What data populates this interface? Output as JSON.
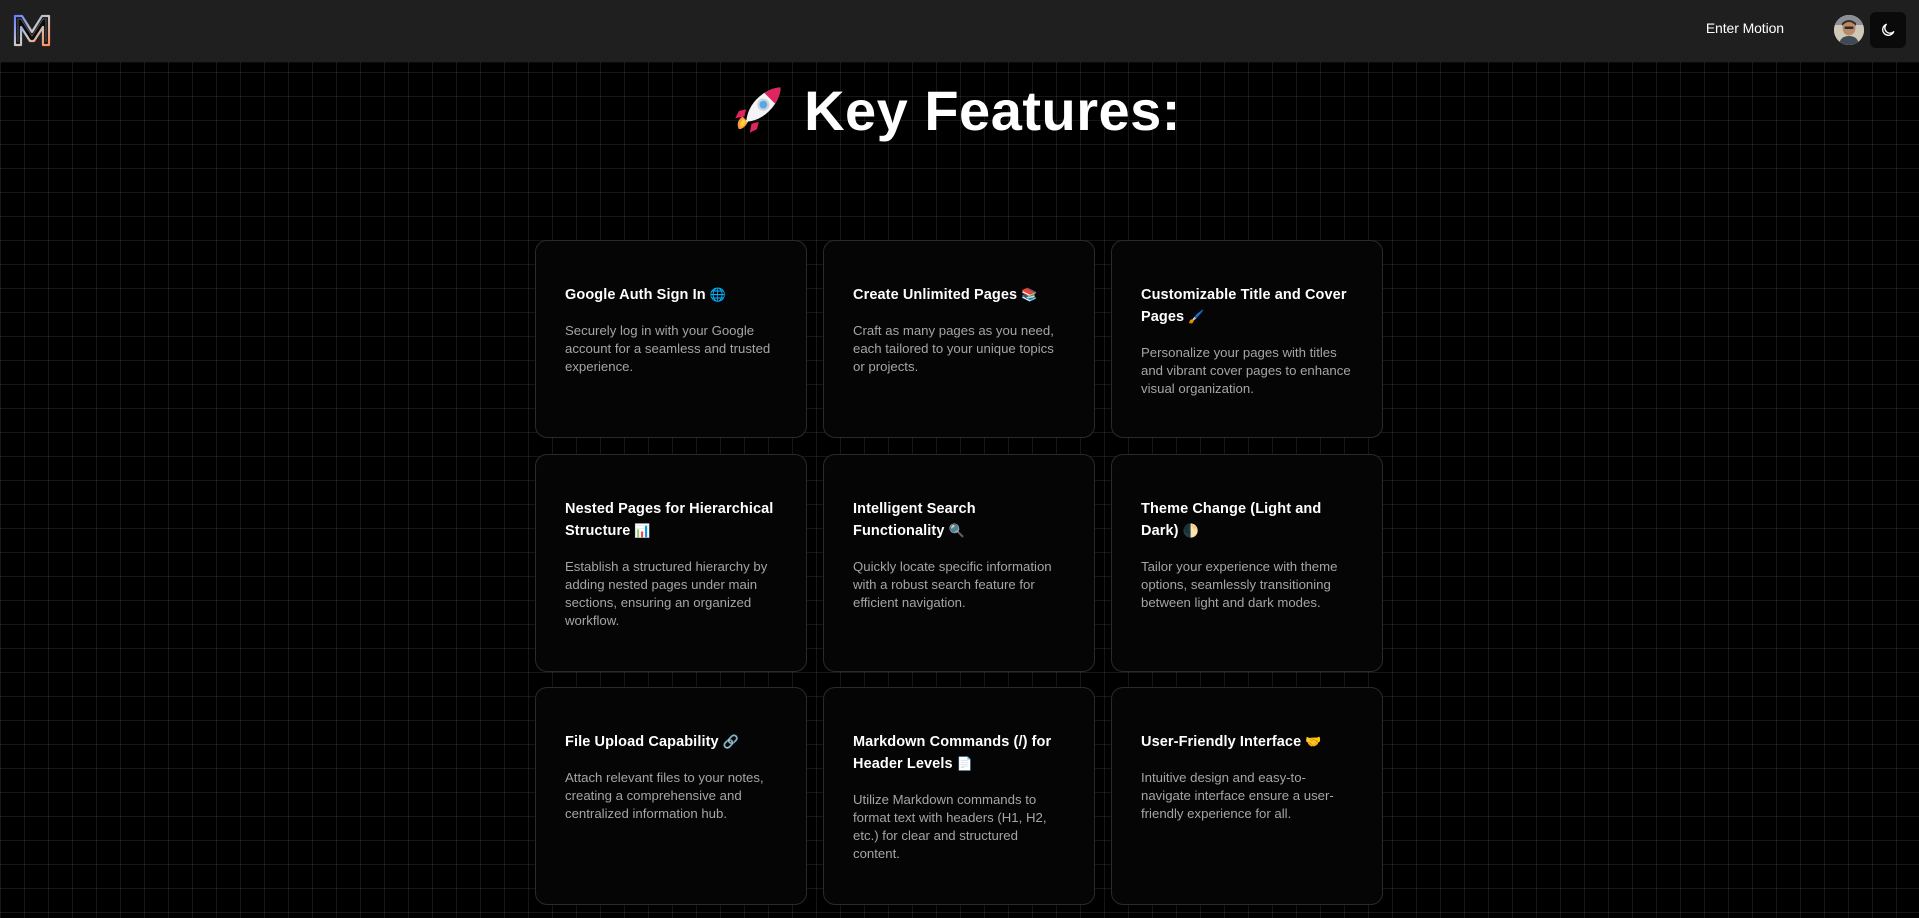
{
  "header": {
    "logo_letter": "M",
    "enter_label": "Enter Motion",
    "theme_icon": "moon-icon"
  },
  "main": {
    "heading": "Key Features:",
    "heading_icon": "rocket-icon",
    "features": [
      {
        "title": "Google Auth Sign In",
        "emoji": "🌐",
        "description": "Securely log in with your Google account for a seamless and trusted experience."
      },
      {
        "title": "Create Unlimited Pages",
        "emoji": "📚",
        "description": "Craft as many pages as you need, each tailored to your unique topics or projects."
      },
      {
        "title": "Customizable Title and Cover Pages",
        "emoji": "🖌️",
        "description": "Personalize your pages with titles and vibrant cover pages to enhance visual organization."
      },
      {
        "title": "Nested Pages for Hierarchical Structure",
        "emoji": "📊",
        "description": "Establish a structured hierarchy by adding nested pages under main sections, ensuring an organized workflow."
      },
      {
        "title": "Intelligent Search Functionality",
        "emoji": "🔍",
        "description": "Quickly locate specific information with a robust search feature for efficient navigation."
      },
      {
        "title": "Theme Change (Light and Dark)",
        "emoji": "🌓",
        "description": "Tailor your experience with theme options, seamlessly transitioning between light and dark modes."
      },
      {
        "title": "File Upload Capability",
        "emoji": "🔗",
        "description": "Attach relevant files to your notes, creating a comprehensive and centralized information hub."
      },
      {
        "title": "Markdown Commands (/) for Header Levels",
        "emoji": "📄",
        "description": "Utilize Markdown commands to format text with headers (H1, H2, etc.) for clear and structured content."
      },
      {
        "title": "User-Friendly Interface",
        "emoji": "🤝",
        "description": "Intuitive design and easy-to-navigate interface ensure a user-friendly experience for all."
      }
    ]
  }
}
